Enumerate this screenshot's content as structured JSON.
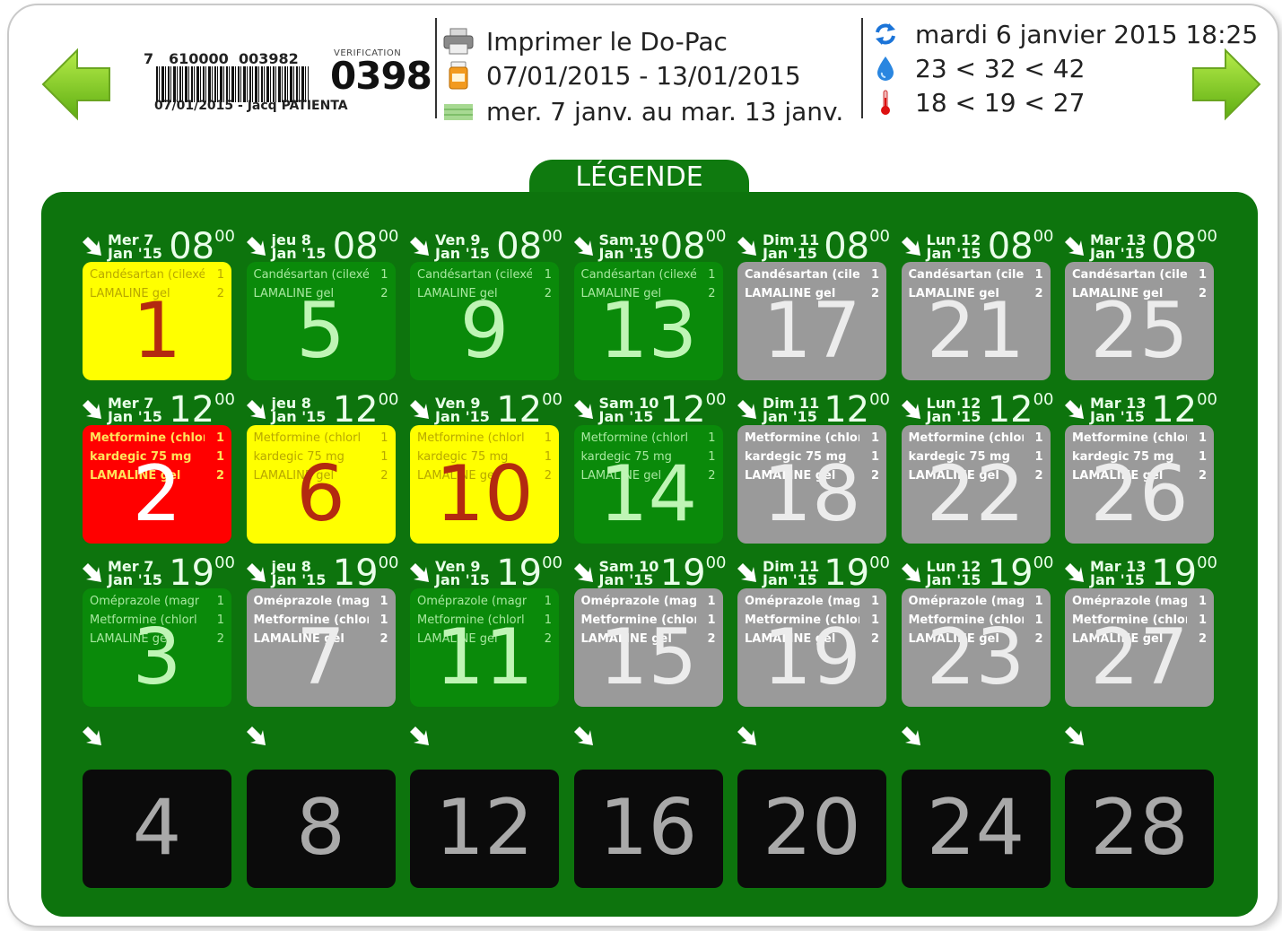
{
  "header": {
    "barcode_left": "7",
    "barcode_mid": "610000",
    "barcode_right": "003982",
    "barcode_caption": "07/01/2015 - Jacq PATIENTA",
    "verification_label": "VERIFICATION",
    "verification_code": "0398",
    "print_label": "Imprimer le Do-Pac",
    "date_range": "07/01/2015 - 13/01/2015",
    "day_range": "mer. 7 janv. au mar. 13 janv.",
    "datetime": "mardi 6 janvier 2015 18:25",
    "humidity_range": "23 < 32 < 42",
    "temperature_range": "18 < 19 < 27"
  },
  "legend_label": "LÉGENDE",
  "columns": [
    {
      "day": "Mer 7",
      "sub": "Jan '15"
    },
    {
      "day": "jeu 8",
      "sub": "Jan '15"
    },
    {
      "day": "Ven 9",
      "sub": "Jan '15"
    },
    {
      "day": "Sam 10",
      "sub": "Jan '15"
    },
    {
      "day": "Dim 11",
      "sub": "Jan '15"
    },
    {
      "day": "Lun 12",
      "sub": "Jan '15"
    },
    {
      "day": "Mar 13",
      "sub": "Jan '15"
    }
  ],
  "rows": [
    {
      "hour": "08",
      "minutes": "00",
      "meds": [
        [
          "Candésartan (cilexé",
          "1"
        ],
        [
          "LAMALINE gel",
          "2"
        ]
      ],
      "cells": [
        {
          "num": "1",
          "status": "yellow"
        },
        {
          "num": "5",
          "status": "green"
        },
        {
          "num": "9",
          "status": "green"
        },
        {
          "num": "13",
          "status": "green"
        },
        {
          "num": "17",
          "status": "gray"
        },
        {
          "num": "21",
          "status": "gray"
        },
        {
          "num": "25",
          "status": "gray"
        }
      ]
    },
    {
      "hour": "12",
      "minutes": "00",
      "meds": [
        [
          "Metformine (chlorl",
          "1"
        ],
        [
          "kardegic 75 mg",
          "1"
        ],
        [
          "LAMALINE gel",
          "2"
        ]
      ],
      "cells": [
        {
          "num": "2",
          "status": "red"
        },
        {
          "num": "6",
          "status": "yellow"
        },
        {
          "num": "10",
          "status": "yellow"
        },
        {
          "num": "14",
          "status": "green"
        },
        {
          "num": "18",
          "status": "gray"
        },
        {
          "num": "22",
          "status": "gray"
        },
        {
          "num": "26",
          "status": "gray"
        }
      ]
    },
    {
      "hour": "19",
      "minutes": "00",
      "meds": [
        [
          "Oméprazole (magr",
          "1"
        ],
        [
          "Metformine (chlorl",
          "1"
        ],
        [
          "LAMALINE gel",
          "2"
        ]
      ],
      "cells": [
        {
          "num": "3",
          "status": "green"
        },
        {
          "num": "7",
          "status": "gray"
        },
        {
          "num": "11",
          "status": "green"
        },
        {
          "num": "15",
          "status": "gray"
        },
        {
          "num": "19",
          "status": "gray"
        },
        {
          "num": "23",
          "status": "gray"
        },
        {
          "num": "27",
          "status": "gray"
        }
      ]
    },
    {
      "hour": "",
      "minutes": "",
      "meds": [],
      "cells": [
        {
          "num": "4",
          "status": "black"
        },
        {
          "num": "8",
          "status": "black"
        },
        {
          "num": "12",
          "status": "black"
        },
        {
          "num": "16",
          "status": "black"
        },
        {
          "num": "20",
          "status": "black"
        },
        {
          "num": "24",
          "status": "black"
        },
        {
          "num": "28",
          "status": "black"
        }
      ]
    }
  ],
  "colors": {
    "board": "#0d740d",
    "yellow": "#ffff00",
    "green": "#0a8a0a",
    "gray": "#9a9a9a",
    "red": "#ff0000",
    "black": "#0b0b0b"
  },
  "icons": {
    "prev": "green-left-arrow-icon",
    "next": "green-right-arrow-icon",
    "print": "printer-icon",
    "pill_bottle": "pill-bottle-icon",
    "calendar": "calendar-strip-icon",
    "refresh": "refresh-icon",
    "humidity": "water-drop-icon",
    "temperature": "thermometer-icon",
    "slot": "diagonal-arrow-icon"
  }
}
